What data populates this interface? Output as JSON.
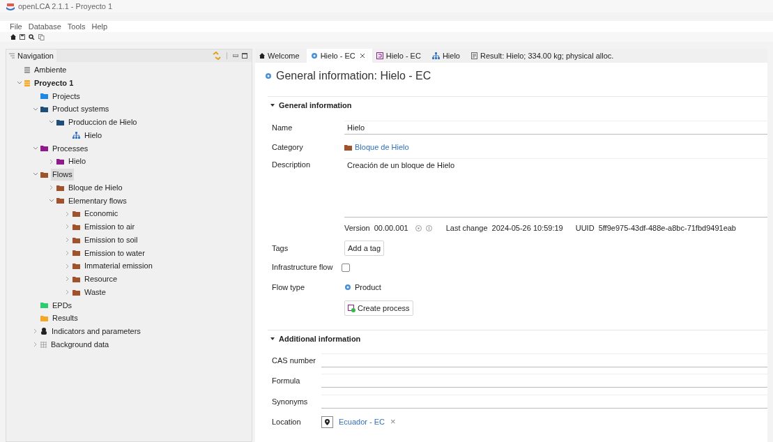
{
  "window": {
    "title": "openLCA 2.1.1 - Proyecto 1"
  },
  "menu": [
    "File",
    "Database",
    "Tools",
    "Help"
  ],
  "navigation": {
    "title": "Navigation",
    "tree": [
      {
        "label": "Ambiente",
        "kind": "database",
        "selected": false
      },
      {
        "label": "Proyecto 1",
        "kind": "database-active",
        "expanded": true,
        "selected": false,
        "children": [
          {
            "label": "Projects",
            "kind": "folder",
            "color": "#1e88e5",
            "selected": false
          },
          {
            "label": "Product systems",
            "kind": "folder",
            "color": "#1f4e79",
            "expanded": true,
            "selected": false,
            "children": [
              {
                "label": "Produccion de Hielo",
                "kind": "folder",
                "color": "#1f4e79",
                "expanded": true,
                "selected": false,
                "children": [
                  {
                    "label": "Hielo",
                    "kind": "system",
                    "selected": false
                  }
                ]
              }
            ]
          },
          {
            "label": "Processes",
            "kind": "folder",
            "color": "#8e1a8e",
            "expanded": true,
            "selected": false,
            "children": [
              {
                "label": "Hielo",
                "kind": "folder",
                "color": "#8e1a8e",
                "expanded": false,
                "selected": false
              }
            ]
          },
          {
            "label": "Flows",
            "kind": "folder",
            "color": "#a0522d",
            "expanded": true,
            "selected": true,
            "children": [
              {
                "label": "Bloque de Hielo",
                "kind": "folder",
                "color": "#a0522d",
                "expanded": false,
                "selected": false
              },
              {
                "label": "Elementary flows",
                "kind": "folder",
                "color": "#a0522d",
                "expanded": true,
                "selected": false,
                "children": [
                  {
                    "label": "Economic",
                    "kind": "folder",
                    "color": "#a0522d",
                    "expanded": false,
                    "selected": false
                  },
                  {
                    "label": "Emission to air",
                    "kind": "folder",
                    "color": "#a0522d",
                    "expanded": false,
                    "selected": false
                  },
                  {
                    "label": "Emission to soil",
                    "kind": "folder",
                    "color": "#a0522d",
                    "expanded": false,
                    "selected": false
                  },
                  {
                    "label": "Emission to water",
                    "kind": "folder",
                    "color": "#a0522d",
                    "expanded": false,
                    "selected": false
                  },
                  {
                    "label": "Immaterial emission",
                    "kind": "folder",
                    "color": "#a0522d",
                    "expanded": false,
                    "selected": false
                  },
                  {
                    "label": "Resource",
                    "kind": "folder",
                    "color": "#a0522d",
                    "expanded": false,
                    "selected": false
                  },
                  {
                    "label": "Waste",
                    "kind": "folder",
                    "color": "#a0522d",
                    "expanded": false,
                    "selected": false
                  }
                ]
              }
            ]
          },
          {
            "label": "EPDs",
            "kind": "folder",
            "color": "#2ecc71",
            "selected": false
          },
          {
            "label": "Results",
            "kind": "folder",
            "color": "#f5a623",
            "selected": false
          },
          {
            "label": "Indicators and parameters",
            "kind": "indicators",
            "expanded": false,
            "selected": false
          },
          {
            "label": "Background data",
            "kind": "background",
            "expanded": false,
            "selected": false
          }
        ]
      }
    ]
  },
  "tabs": [
    {
      "label": "Welcome",
      "kind": "home",
      "selected": false
    },
    {
      "label": "Hielo - EC",
      "kind": "flow",
      "selected": true
    },
    {
      "label": "Hielo - EC",
      "kind": "process",
      "selected": false
    },
    {
      "label": "Hielo",
      "kind": "system",
      "selected": false
    },
    {
      "label": "Result: Hielo; 334.00 kg; physical alloc.",
      "kind": "result",
      "selected": false
    }
  ],
  "editor": {
    "title": "General information: Hielo - EC",
    "general": {
      "title": "General information",
      "name_label": "Name",
      "name": "Hielo",
      "category_label": "Category",
      "category": "Bloque de Hielo",
      "description_label": "Description",
      "description": "Creación de un bloque de Hielo",
      "version_label": "Version",
      "version": "00.00.001",
      "last_change_label": "Last change",
      "last_change": "2024-05-26 10:59:19",
      "uuid_label": "UUID",
      "uuid": "5ff9e975-43df-488e-a8bc-71fbd9491eab",
      "tags_label": "Tags",
      "add_tag": "Add a tag",
      "infrastructure_label": "Infrastructure flow",
      "infrastructure_checked": false,
      "flow_type_label": "Flow type",
      "flow_type": "Product",
      "create_process": "Create process"
    },
    "additional": {
      "title": "Additional information",
      "fields": [
        {
          "label": "CAS number"
        },
        {
          "label": "Formula"
        },
        {
          "label": "Synonyms"
        }
      ],
      "location_label": "Location",
      "location": "Ecuador - EC",
      "remove": "×"
    }
  }
}
